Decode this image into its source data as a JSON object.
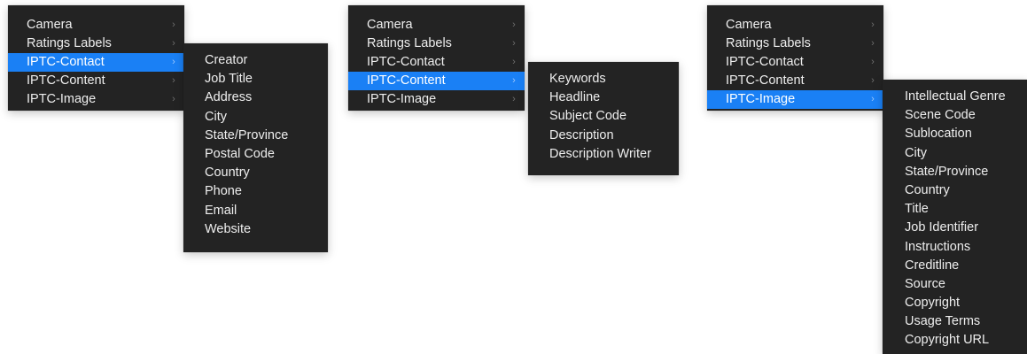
{
  "panels": [
    {
      "main_items": [
        {
          "label": "Camera",
          "selected": false
        },
        {
          "label": "Ratings Labels",
          "selected": false
        },
        {
          "label": "IPTC-Contact",
          "selected": true
        },
        {
          "label": "IPTC-Content",
          "selected": false
        },
        {
          "label": "IPTC-Image",
          "selected": false
        }
      ],
      "submenu_items": [
        "Creator",
        "Job Title",
        "Address",
        "City",
        "State/Province",
        "Postal Code",
        "Country",
        "Phone",
        "Email",
        "Website"
      ]
    },
    {
      "main_items": [
        {
          "label": "Camera",
          "selected": false
        },
        {
          "label": "Ratings Labels",
          "selected": false
        },
        {
          "label": "IPTC-Contact",
          "selected": false
        },
        {
          "label": "IPTC-Content",
          "selected": true
        },
        {
          "label": "IPTC-Image",
          "selected": false
        }
      ],
      "submenu_items": [
        "Keywords",
        "Headline",
        "Subject Code",
        "Description",
        "Description Writer"
      ]
    },
    {
      "main_items": [
        {
          "label": "Camera",
          "selected": false
        },
        {
          "label": "Ratings Labels",
          "selected": false
        },
        {
          "label": "IPTC-Contact",
          "selected": false
        },
        {
          "label": "IPTC-Content",
          "selected": false
        },
        {
          "label": "IPTC-Image",
          "selected": true
        }
      ],
      "submenu_items": [
        "Intellectual Genre",
        "Scene Code",
        "Sublocation",
        "City",
        "State/Province",
        "Country",
        "Title",
        "Job Identifier",
        "Instructions",
        "Creditline",
        "Source",
        "Copyright",
        "Usage Terms",
        "Copyright URL"
      ]
    }
  ],
  "chevron_glyph": "›",
  "chevron_icon": "chevron-right-icon",
  "colors": {
    "menu_background": "#232323",
    "menu_text": "#eeeeee",
    "selection_highlight": "#1a80f5",
    "chevron": "#6f6f6f"
  }
}
